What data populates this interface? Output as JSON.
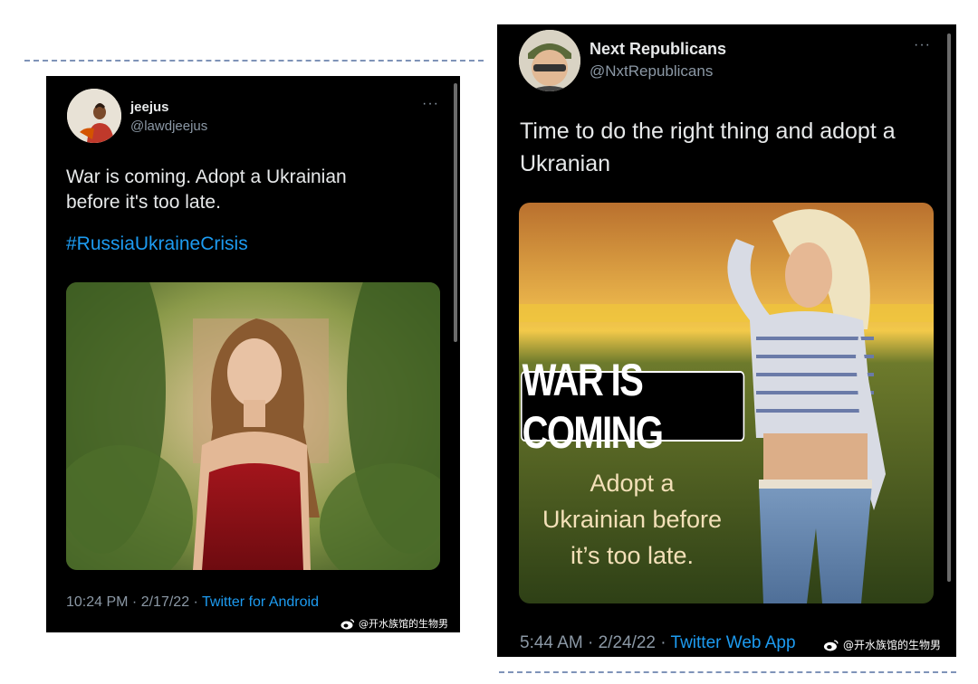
{
  "tweet_left": {
    "display_name": "jeejus",
    "handle": "@lawdjeejus",
    "more_label": "···",
    "text": "War is coming. Adopt a Ukrainian\nbefore it's too late.",
    "hashtag": "#RussiaUkraineCrisis",
    "time_date": "10:24 PM · 2/17/22 · ",
    "source": "Twitter for Android",
    "watermark": "@开水族馆的生物男"
  },
  "tweet_right": {
    "display_name": "Next Republicans",
    "handle": "@NxtRepublicans",
    "more_label": "···",
    "text": "Time to do the right thing and adopt a\nUkranian",
    "image_overlay_title": "WAR IS COMING",
    "image_overlay_text": "Adopt a\nUkrainian before\nit’s too late.",
    "time_date": "5:44 AM · 2/24/22 · ",
    "source": "Twitter Web App",
    "watermark": "@开水族馆的生物男"
  },
  "colors": {
    "card_bg": "#000000",
    "text": "#e7e9ea",
    "muted": "#8b98a5",
    "link": "#1d9bf0",
    "dashed_line": "#7f93b8"
  }
}
